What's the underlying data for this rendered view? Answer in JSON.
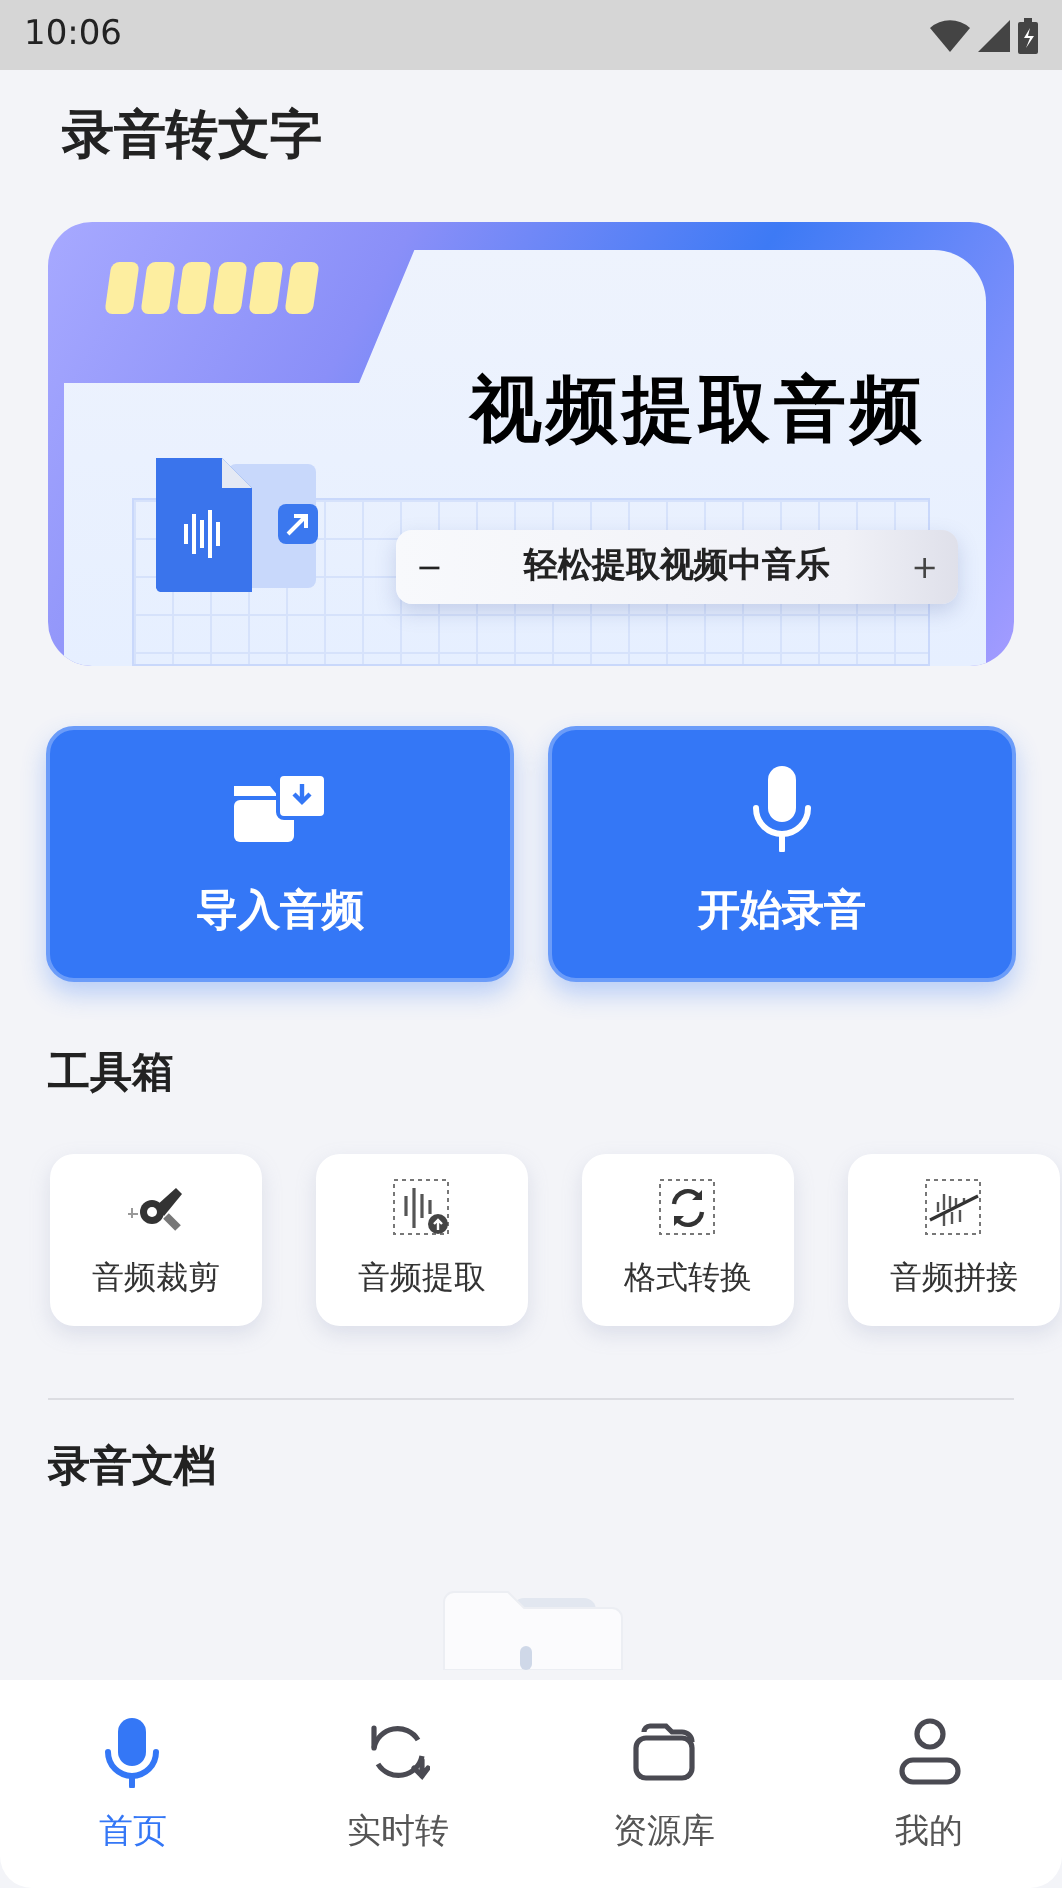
{
  "status_bar": {
    "time": "10:06"
  },
  "page_title": "录音转文字",
  "banner": {
    "title": "视频提取音频",
    "subtitle": "轻松提取视频中音乐",
    "minus": "−",
    "plus": "+"
  },
  "actions": [
    {
      "kind": "import",
      "label": "导入音频"
    },
    {
      "kind": "record",
      "label": "开始录音"
    }
  ],
  "toolbox": {
    "title": "工具箱",
    "tools": [
      {
        "kind": "cut",
        "label": "音频裁剪"
      },
      {
        "kind": "extract",
        "label": "音频提取"
      },
      {
        "kind": "convert",
        "label": "格式转换"
      },
      {
        "kind": "join",
        "label": "音频拼接"
      }
    ]
  },
  "documents": {
    "title": "录音文档"
  },
  "nav": [
    {
      "kind": "mic",
      "label": "首页",
      "selected": true
    },
    {
      "kind": "sync",
      "label": "实时转",
      "selected": false
    },
    {
      "kind": "folders",
      "label": "资源库",
      "selected": false
    },
    {
      "kind": "user",
      "label": "我的",
      "selected": false
    }
  ]
}
